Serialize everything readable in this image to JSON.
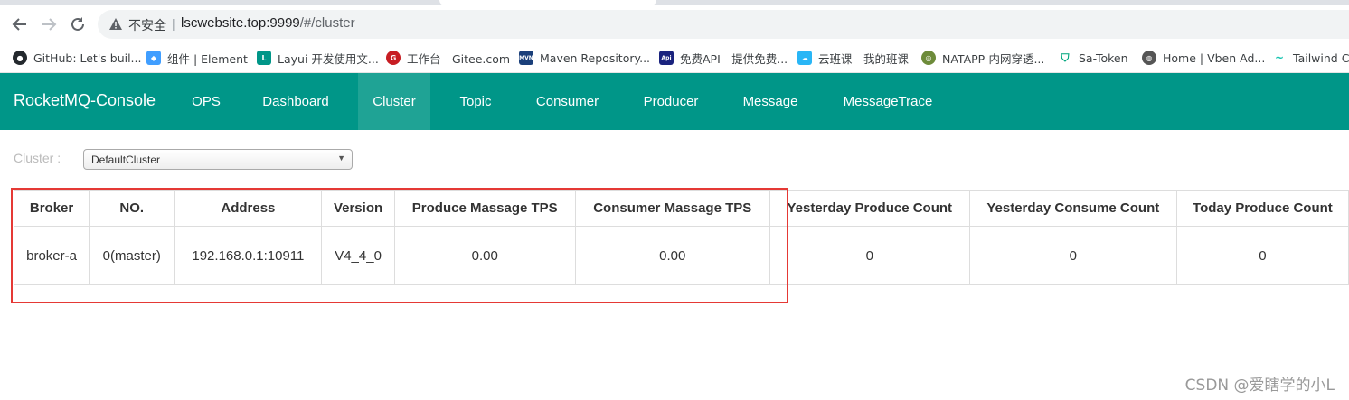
{
  "browser": {
    "security_label": "不安全",
    "url_host": "lscwebsite.top:9999",
    "url_path": "/#/cluster",
    "bookmarks": [
      {
        "label": "GitHub: Let's buil...",
        "icon": "github-icon",
        "color": "#24292e"
      },
      {
        "label": "组件 | Element",
        "icon": "element-icon",
        "color": "#409eff"
      },
      {
        "label": "Layui 开发使用文...",
        "icon": "layui-icon",
        "color": "#009688"
      },
      {
        "label": "工作台 - Gitee.com",
        "icon": "gitee-icon",
        "color": "#c71d23"
      },
      {
        "label": "Maven Repository...",
        "icon": "maven-icon",
        "color": "#1a3f7a"
      },
      {
        "label": "免费API - 提供免费...",
        "icon": "api-icon",
        "color": "#1a237e"
      },
      {
        "label": "云班课 - 我的班课",
        "icon": "cloud-class-icon",
        "color": "#29b6f6"
      },
      {
        "label": "NATAPP-内网穿透...",
        "icon": "natapp-icon",
        "color": "#6d8b3a"
      },
      {
        "label": "Sa-Token",
        "icon": "shield-icon",
        "color": "#00a67e"
      },
      {
        "label": "Home | Vben Ad...",
        "icon": "globe-icon",
        "color": "#555555"
      },
      {
        "label": "Tailwind CS",
        "icon": "tailwind-icon",
        "color": "#16c3b0"
      }
    ]
  },
  "app": {
    "brand": "RocketMQ-Console",
    "nav": [
      "OPS",
      "Dashboard",
      "Cluster",
      "Topic",
      "Consumer",
      "Producer",
      "Message",
      "MessageTrace"
    ],
    "active_nav": "Cluster",
    "accent": "#009688"
  },
  "cluster": {
    "label": "Cluster :",
    "selected": "DefaultCluster"
  },
  "table": {
    "headers": [
      "Broker",
      "NO.",
      "Address",
      "Version",
      "Produce Massage TPS",
      "Consumer Massage TPS",
      "Yesterday Produce Count",
      "Yesterday Consume Count",
      "Today Produce Count"
    ],
    "rows": [
      [
        "broker-a",
        "0(master)",
        "192.168.0.1:10911",
        "V4_4_0",
        "0.00",
        "0.00",
        "0",
        "0",
        "0"
      ]
    ]
  },
  "watermark": "CSDN @爱瞎学的小L",
  "highlight_color": "#e53935"
}
